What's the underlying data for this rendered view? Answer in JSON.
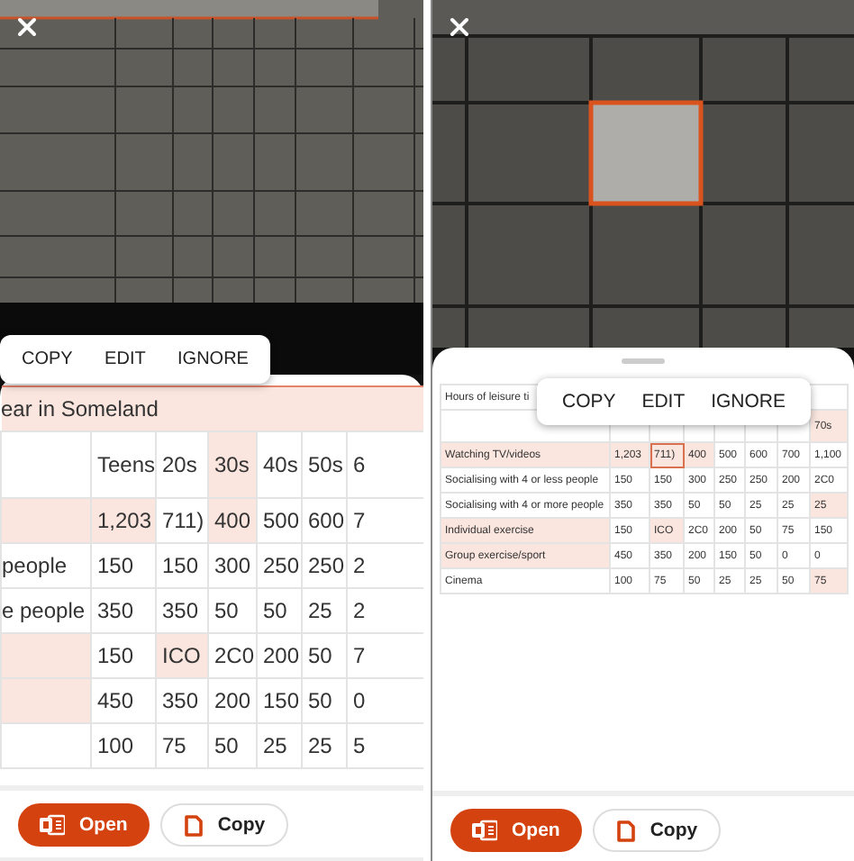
{
  "screens": [
    {
      "kind": "zoomed",
      "popup": {
        "actions": [
          "COPY",
          "EDIT",
          "IGNORE"
        ]
      },
      "table": {
        "rows": [
          {
            "kind": "title",
            "text": "ear in Someland"
          },
          {
            "kind": "data",
            "cells": [
              {
                "highlighted": false,
                "outlined": false
              },
              {
                "text": "Teens",
                "highlighted": false,
                "outlined": false
              },
              {
                "text": "20s",
                "highlighted": false,
                "outlined": false
              },
              {
                "text": "30s",
                "highlighted": true,
                "outlined": false
              },
              {
                "text": "40s",
                "highlighted": false,
                "outlined": false
              },
              {
                "text": "50s",
                "highlighted": false,
                "outlined": false
              },
              {
                "text": "6",
                "highlighted": false,
                "outlined": false
              }
            ]
          },
          {
            "kind": "data",
            "cells": [
              {
                "highlighted": true,
                "outlined": false
              },
              {
                "text": "1,203",
                "highlighted": true,
                "outlined": false
              },
              {
                "text": "711)",
                "highlighted": false,
                "outlined": false
              },
              {
                "text": "400",
                "highlighted": true,
                "outlined": false
              },
              {
                "text": "500",
                "highlighted": false,
                "outlined": false
              },
              {
                "text": "600",
                "highlighted": false,
                "outlined": false
              },
              {
                "text": "7",
                "highlighted": false,
                "outlined": false
              }
            ]
          },
          {
            "kind": "data",
            "cells": [
              {
                "text": "people",
                "highlighted": false,
                "outlined": false
              },
              {
                "text": "150",
                "highlighted": false,
                "outlined": false
              },
              {
                "text": "150",
                "highlighted": false,
                "outlined": false
              },
              {
                "text": "300",
                "highlighted": false,
                "outlined": false
              },
              {
                "text": "250",
                "highlighted": false,
                "outlined": false
              },
              {
                "text": "250",
                "highlighted": false,
                "outlined": false
              },
              {
                "text": "2",
                "highlighted": false,
                "outlined": false
              }
            ]
          },
          {
            "kind": "data",
            "cells": [
              {
                "text": "e people",
                "highlighted": false,
                "outlined": false
              },
              {
                "text": "350",
                "highlighted": false,
                "outlined": false
              },
              {
                "text": "350",
                "highlighted": false,
                "outlined": false
              },
              {
                "text": "50",
                "highlighted": false,
                "outlined": false
              },
              {
                "text": "50",
                "highlighted": false,
                "outlined": false
              },
              {
                "text": "25",
                "highlighted": false,
                "outlined": false
              },
              {
                "text": "2",
                "highlighted": false,
                "outlined": false
              }
            ]
          },
          {
            "kind": "data",
            "cells": [
              {
                "highlighted": true,
                "outlined": false
              },
              {
                "text": "150",
                "highlighted": false,
                "outlined": false
              },
              {
                "text": "ICO",
                "highlighted": true,
                "outlined": false
              },
              {
                "text": "2C0",
                "highlighted": false,
                "outlined": false
              },
              {
                "text": "200",
                "highlighted": false,
                "outlined": false
              },
              {
                "text": "50",
                "highlighted": false,
                "outlined": false
              },
              {
                "text": "7",
                "highlighted": false,
                "outlined": false
              }
            ]
          },
          {
            "kind": "data",
            "cells": [
              {
                "highlighted": true,
                "outlined": false
              },
              {
                "text": "450",
                "highlighted": false,
                "outlined": false
              },
              {
                "text": "350",
                "highlighted": false,
                "outlined": false
              },
              {
                "text": "200",
                "highlighted": false,
                "outlined": false
              },
              {
                "text": "150",
                "highlighted": false,
                "outlined": false
              },
              {
                "text": "50",
                "highlighted": false,
                "outlined": false
              },
              {
                "text": "0",
                "highlighted": false,
                "outlined": false
              }
            ]
          },
          {
            "kind": "data",
            "cells": [
              {
                "highlighted": false,
                "outlined": false
              },
              {
                "text": "100",
                "highlighted": false,
                "outlined": false
              },
              {
                "text": "75",
                "highlighted": false,
                "outlined": false
              },
              {
                "text": "50",
                "highlighted": false,
                "outlined": false
              },
              {
                "text": "25",
                "highlighted": false,
                "outlined": false
              },
              {
                "text": "25",
                "highlighted": false,
                "outlined": false
              },
              {
                "text": "5",
                "highlighted": false,
                "outlined": false
              }
            ]
          }
        ]
      },
      "buttons": [
        {
          "kind": "primary",
          "label": "Open"
        },
        {
          "kind": "secondary",
          "label": "Copy"
        }
      ]
    },
    {
      "kind": "full",
      "popup": {
        "actions": [
          "COPY",
          "EDIT",
          "IGNORE"
        ]
      },
      "table": {
        "rows": [
          {
            "kind": "caption",
            "text": "Hours of leisure ti"
          },
          {
            "kind": "data",
            "cells": [
              {
                "highlighted": false,
                "outlined": false
              },
              {
                "highlighted": false,
                "outlined": false
              },
              {
                "highlighted": false,
                "outlined": false
              },
              {
                "highlighted": false,
                "outlined": false
              },
              {
                "highlighted": false,
                "outlined": false
              },
              {
                "highlighted": false,
                "outlined": false
              },
              {
                "highlighted": false,
                "outlined": false
              },
              {
                "text": "70s",
                "highlighted": true,
                "outlined": false
              }
            ]
          },
          {
            "kind": "data",
            "cells": [
              {
                "text": "Watching TV/videos",
                "highlighted": true,
                "outlined": false
              },
              {
                "text": "1,203",
                "highlighted": true,
                "outlined": false
              },
              {
                "text": "711)",
                "highlighted": true,
                "outlined": true
              },
              {
                "text": "400",
                "highlighted": true,
                "outlined": false
              },
              {
                "text": "500",
                "highlighted": false,
                "outlined": false
              },
              {
                "text": "600",
                "highlighted": false,
                "outlined": false
              },
              {
                "text": "700",
                "highlighted": false,
                "outlined": false
              },
              {
                "text": "1,100",
                "highlighted": false,
                "outlined": false
              }
            ]
          },
          {
            "kind": "data",
            "cells": [
              {
                "text": "Socialising with 4 or less people",
                "highlighted": false,
                "outlined": false
              },
              {
                "text": "150",
                "highlighted": false,
                "outlined": false
              },
              {
                "text": "150",
                "highlighted": false,
                "outlined": false
              },
              {
                "text": "300",
                "highlighted": false,
                "outlined": false
              },
              {
                "text": "250",
                "highlighted": false,
                "outlined": false
              },
              {
                "text": "250",
                "highlighted": false,
                "outlined": false
              },
              {
                "text": "200",
                "highlighted": false,
                "outlined": false
              },
              {
                "text": "2C0",
                "highlighted": false,
                "outlined": false
              }
            ]
          },
          {
            "kind": "data",
            "cells": [
              {
                "text": "Socialising with 4 or more people",
                "highlighted": false,
                "outlined": false
              },
              {
                "text": "350",
                "highlighted": false,
                "outlined": false
              },
              {
                "text": "350",
                "highlighted": false,
                "outlined": false
              },
              {
                "text": "50",
                "highlighted": false,
                "outlined": false
              },
              {
                "text": "50",
                "highlighted": false,
                "outlined": false
              },
              {
                "text": "25",
                "highlighted": false,
                "outlined": false
              },
              {
                "text": "25",
                "highlighted": false,
                "outlined": false
              },
              {
                "text": "25",
                "highlighted": true,
                "outlined": false
              }
            ]
          },
          {
            "kind": "data",
            "cells": [
              {
                "text": "Individual exercise",
                "highlighted": true,
                "outlined": false
              },
              {
                "text": "150",
                "highlighted": false,
                "outlined": false
              },
              {
                "text": "ICO",
                "highlighted": true,
                "outlined": false
              },
              {
                "text": "2C0",
                "highlighted": false,
                "outlined": false
              },
              {
                "text": "200",
                "highlighted": false,
                "outlined": false
              },
              {
                "text": "50",
                "highlighted": false,
                "outlined": false
              },
              {
                "text": "75",
                "highlighted": false,
                "outlined": false
              },
              {
                "text": "150",
                "highlighted": false,
                "outlined": false
              }
            ]
          },
          {
            "kind": "data",
            "cells": [
              {
                "text": "Group exercise/sport",
                "highlighted": true,
                "outlined": false
              },
              {
                "text": "450",
                "highlighted": false,
                "outlined": false
              },
              {
                "text": "350",
                "highlighted": false,
                "outlined": false
              },
              {
                "text": "200",
                "highlighted": false,
                "outlined": false
              },
              {
                "text": "150",
                "highlighted": false,
                "outlined": false
              },
              {
                "text": "50",
                "highlighted": false,
                "outlined": false
              },
              {
                "text": "0",
                "highlighted": false,
                "outlined": false
              },
              {
                "text": "0",
                "highlighted": false,
                "outlined": false
              }
            ]
          },
          {
            "kind": "data",
            "cells": [
              {
                "text": "Cinema",
                "highlighted": false,
                "outlined": false
              },
              {
                "text": "100",
                "highlighted": false,
                "outlined": false
              },
              {
                "text": "75",
                "highlighted": false,
                "outlined": false
              },
              {
                "text": "50",
                "highlighted": false,
                "outlined": false
              },
              {
                "text": "25",
                "highlighted": false,
                "outlined": false
              },
              {
                "text": "25",
                "highlighted": false,
                "outlined": false
              },
              {
                "text": "50",
                "highlighted": false,
                "outlined": false
              },
              {
                "text": "75",
                "highlighted": true,
                "outlined": false
              }
            ]
          }
        ]
      },
      "buttons": [
        {
          "kind": "primary",
          "label": "Open"
        },
        {
          "kind": "secondary",
          "label": "Copy"
        }
      ]
    }
  ]
}
